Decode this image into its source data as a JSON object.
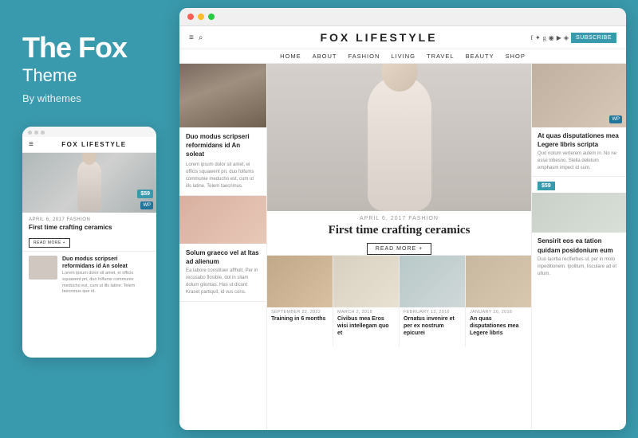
{
  "left": {
    "title": "The Fox",
    "subtitle": "Theme",
    "by": "By withemes"
  },
  "mobile": {
    "logo": "FOX LIFESTYLE",
    "hamburger": "≡",
    "meta": "APRIL 6, 2017   FASHION",
    "article_title": "First time crafting ceramics",
    "read_more": "READ MORE +",
    "price": "$59",
    "wp": "WP",
    "small_article_title": "Duo modus scripseri reformidans id An soleat",
    "small_article_text": "Lorem ipsum dolor sit amet, ei officis squawent pri, duo folfums communie meducho est, cum ut ills latine. Telem taecrimus que id."
  },
  "browser": {
    "site_logo": "FOX LIFESTYLE",
    "subscribe": "SUBSCRIBE",
    "nav": [
      "HOME",
      "ABOUT",
      "FASHION",
      "LIVING",
      "TRAVEL",
      "BEAUTY",
      "SHOP"
    ],
    "hero": {
      "meta": "APRIL 6, 2017   FASHION",
      "title": "First time crafting ceramics",
      "read_more": "READ MORE +"
    },
    "left_col": {
      "article1_title": "Duo modus scripseri reformidans id An soleat",
      "article1_text": "Lorem ipsum dolor sit amet, ei officis squawent pri, duo folfums communie meducho est, cum ut ills latine. Telem taecrimus.",
      "article2_title": "Solum graeco vel at Itas ad alienum",
      "article2_text": "Ea labore constituer affhult. Per in recusabo flosible, dol in sliam dolum gliontas. Has ut dicunt Kraset partiquit, id vus cons."
    },
    "right_col": {
      "article1_title": "At quas disputationes mea Legere libris scripta",
      "article1_text": "Quo notum verterem autem in. No ne esse lobesno. Stella deletum emphasm impect id sum.",
      "price": "$59",
      "wp": "WP",
      "article2_title": "Sensirit eos ea tation quidam posidonium eum",
      "article2_text": "Duo laorba recIferbes ul, per in molo inpeditionem. Ipolitum, Iisculare ad et ullum."
    },
    "bottom": [
      {
        "meta": "SEPTEMBER 22, 2022",
        "title": "Training in 6 months"
      },
      {
        "meta": "MARCH 2, 2018",
        "title": "Civibus mea Eros wisi intellegam quo et"
      },
      {
        "meta": "FEBRUARY 12, 2016",
        "title": "Ornatus invenire et per ex nostrum epicurei"
      },
      {
        "meta": "JANUARY 20, 2016",
        "title": "An quas disputationes mea Legere libris"
      }
    ]
  }
}
